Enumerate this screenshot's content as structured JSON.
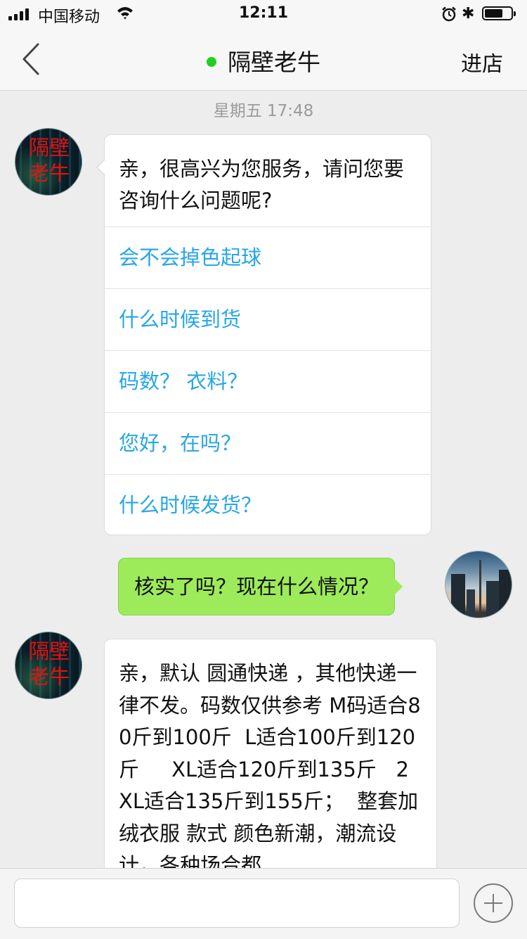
{
  "status_bar": {
    "carrier": "中国移动",
    "time": "12:11",
    "bluetooth_symbol": "✱",
    "battery_level": 0.7
  },
  "nav": {
    "back_icon": "chevron-left-icon",
    "title": "隔壁老牛",
    "online_color": "#1fcf1f",
    "right_action": "进店"
  },
  "chat": {
    "timestamp": "星期五 17:48",
    "shop_avatar_text": [
      "隔壁",
      "老牛"
    ],
    "greeting": {
      "text": "亲，很高兴为您服务，请问您要咨询什么问题呢?",
      "quick_replies": [
        "会不会掉色起球",
        "什么时候到货",
        "码数？ 衣料？",
        "您好，在吗？",
        "什么时候发货？"
      ]
    },
    "user_message": "核实了吗？现在什么情况？",
    "reply_text": "亲，默认 圆通快递 ，其他快递一律不发。码数仅供参考 M码适合80斤到100斤  L适合100斤到120斤     XL适合120斤到135斤   2XL适合135斤到155斤；  整套加绒衣服 款式 颜色新潮，潮流设计，各种场合都"
  },
  "input_bar": {
    "text_value": "",
    "plus_icon": "plus-circle-icon"
  },
  "colors": {
    "link": "#27a6e6",
    "sent_bubble": "#9deb5b",
    "background": "#ededed"
  }
}
